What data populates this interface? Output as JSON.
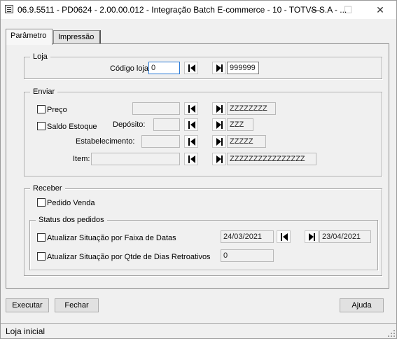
{
  "window": {
    "title": "06.9.5511 - PD0624 - 2.00.00.012 - Integração Batch E-commerce - 10 - TOTVS S.A - ..."
  },
  "titlebar": {
    "minimize": "—",
    "maximize": "☐",
    "close": "✕"
  },
  "tabs": [
    {
      "label": "Parâmetro"
    },
    {
      "label": "Impressão"
    }
  ],
  "loja": {
    "group_title": "Loja",
    "codigo_label": "Código loja:",
    "codigo_inicial": "0",
    "codigo_final": "999999"
  },
  "enviar": {
    "group_title": "Enviar",
    "preco": {
      "label": "Preço",
      "checked": false,
      "inicial": "",
      "final": "ZZZZZZZZ"
    },
    "saldo_estoque": {
      "label": "Saldo Estoque",
      "checked": false
    },
    "deposito": {
      "label": "Depósito:",
      "inicial": "",
      "final": "ZZZ"
    },
    "estabelecimento": {
      "label": "Estabelecimento:",
      "inicial": "",
      "final": "ZZZZZ"
    },
    "item": {
      "label": "Item:",
      "inicial": "",
      "final": "ZZZZZZZZZZZZZZZZ"
    }
  },
  "receber": {
    "group_title": "Receber",
    "pedido_venda": {
      "label": "Pedido Venda",
      "checked": false
    },
    "status": {
      "group_title": "Status dos pedidos",
      "faixa_datas": {
        "label": "Atualizar Situação por Faixa de Datas",
        "checked": false,
        "inicial": "24/03/2021",
        "final": "23/04/2021"
      },
      "dias_retroativos": {
        "label": "Atualizar Situação por Qtde de Dias Retroativos",
        "checked": false,
        "value": "0"
      }
    }
  },
  "buttons": {
    "executar": "Executar",
    "fechar": "Fechar",
    "ajuda": "Ajuda"
  },
  "statusbar": {
    "text": "Loja inicial"
  }
}
